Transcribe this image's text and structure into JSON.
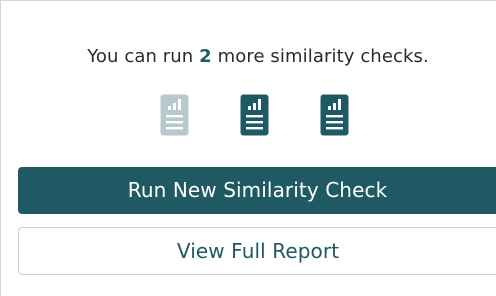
{
  "message": {
    "prefix": "You can run ",
    "count": "2",
    "suffix": " more similarity checks."
  },
  "checks": [
    {
      "state": "used",
      "icon": "report-icon"
    },
    {
      "state": "available",
      "icon": "report-icon"
    },
    {
      "state": "available",
      "icon": "report-icon"
    }
  ],
  "colors": {
    "primary": "#1f5963",
    "used_icon": "#b7c9cc",
    "text": "#2b2b2b"
  },
  "buttons": {
    "run_new": "Run New Similarity Check",
    "view_report": "View Full Report"
  }
}
